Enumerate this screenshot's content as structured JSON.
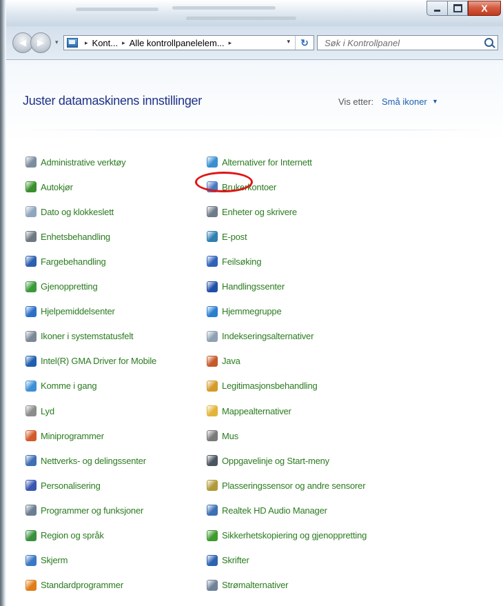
{
  "window": {
    "caption_buttons": {
      "minimize_icon": "minimize-icon",
      "maximize_icon": "maximize-icon",
      "close_label": "X"
    }
  },
  "toolbar": {
    "back_icon": "back-arrow-icon",
    "forward_icon": "forward-arrow-icon",
    "address": {
      "icon": "control-panel-icon",
      "breadcrumb": [
        "Kont...",
        "Alle kontrollpanelelem..."
      ],
      "separator": "▸",
      "dropdown_glyph": "▾",
      "refresh_glyph": "↻"
    },
    "search": {
      "placeholder": "Søk i Kontrollpanel",
      "icon": "search-icon"
    }
  },
  "main": {
    "title": "Juster datamaskinens innstillinger",
    "view_by": {
      "label": "Vis etter:",
      "value": "Små ikoner",
      "caret": "▼"
    },
    "columns": [
      {
        "items": [
          {
            "label": "Administrative verktøy",
            "icon": "administrative-tools-icon",
            "color": "#7d8c9e"
          },
          {
            "label": "Autokjør",
            "icon": "autoplay-icon",
            "color": "#3a8e2d"
          },
          {
            "label": "Dato og klokkeslett",
            "icon": "date-time-icon",
            "color": "#8fa6bf"
          },
          {
            "label": "Enhetsbehandling",
            "icon": "device-manager-icon",
            "color": "#6f7780"
          },
          {
            "label": "Fargebehandling",
            "icon": "color-management-icon",
            "color": "#2b5fb0"
          },
          {
            "label": "Gjenoppretting",
            "icon": "recovery-icon",
            "color": "#3a9a3a"
          },
          {
            "label": "Hjelpemiddelsenter",
            "icon": "ease-of-access-icon",
            "color": "#2d6fc8"
          },
          {
            "label": "Ikoner i systemstatusfelt",
            "icon": "notification-area-icon",
            "color": "#7a8896"
          },
          {
            "label": "Intel(R) GMA Driver for Mobile",
            "icon": "intel-gma-icon",
            "color": "#1f5fae"
          },
          {
            "label": "Komme i gang",
            "icon": "getting-started-icon",
            "color": "#3e8fd6"
          },
          {
            "label": "Lyd",
            "icon": "sound-icon",
            "color": "#8c8c8c"
          },
          {
            "label": "Miniprogrammer",
            "icon": "gadgets-icon",
            "color": "#d35a2a"
          },
          {
            "label": "Nettverks- og delingssenter",
            "icon": "network-sharing-icon",
            "color": "#3f6eb5"
          },
          {
            "label": "Personalisering",
            "icon": "personalization-icon",
            "color": "#3a56b0"
          },
          {
            "label": "Programmer og funksjoner",
            "icon": "programs-features-icon",
            "color": "#6b7d90"
          },
          {
            "label": "Region og språk",
            "icon": "region-language-icon",
            "color": "#3b8f3f"
          },
          {
            "label": "Skjerm",
            "icon": "display-icon",
            "color": "#3a77c4"
          },
          {
            "label": "Standardprogrammer",
            "icon": "default-programs-icon",
            "color": "#e07d1a"
          }
        ]
      },
      {
        "items": [
          {
            "label": "Alternativer for Internett",
            "icon": "internet-options-icon",
            "color": "#3a8fd1"
          },
          {
            "label": "Brukerkontoer",
            "icon": "user-accounts-icon",
            "color": "#4a78c0"
          },
          {
            "label": "Enheter og skrivere",
            "icon": "devices-printers-icon",
            "color": "#6e7b88"
          },
          {
            "label": "E-post",
            "icon": "mail-icon",
            "color": "#2f7fb0",
            "highlighted": true
          },
          {
            "label": "Feilsøking",
            "icon": "troubleshooting-icon",
            "color": "#2f63b8"
          },
          {
            "label": "Handlingssenter",
            "icon": "action-center-flag-icon",
            "color": "#1f4fa8"
          },
          {
            "label": "Hjemmegruppe",
            "icon": "homegroup-icon",
            "color": "#2a7fd0"
          },
          {
            "label": "Indekseringsalternativer",
            "icon": "indexing-options-icon",
            "color": "#8ea0b2"
          },
          {
            "label": "Java",
            "icon": "java-icon",
            "color": "#c65a2a"
          },
          {
            "label": "Legitimasjonsbehandling",
            "icon": "credential-manager-icon",
            "color": "#d49a2a"
          },
          {
            "label": "Mappealternativer",
            "icon": "folder-options-icon",
            "color": "#e3b43a"
          },
          {
            "label": "Mus",
            "icon": "mouse-icon",
            "color": "#7a7a7a"
          },
          {
            "label": "Oppgavelinje og Start-meny",
            "icon": "taskbar-start-icon",
            "color": "#4a5560"
          },
          {
            "label": "Plasseringssensor og andre sensorer",
            "icon": "location-sensors-icon",
            "color": "#b09a3a"
          },
          {
            "label": "Realtek HD Audio Manager",
            "icon": "realtek-audio-icon",
            "color": "#3c6fb4"
          },
          {
            "label": "Sikkerhetskopiering og gjenoppretting",
            "icon": "backup-restore-icon",
            "color": "#3f9a2f"
          },
          {
            "label": "Skrifter",
            "icon": "fonts-icon",
            "color": "#2d62b2"
          },
          {
            "label": "Strømalternativer",
            "icon": "power-options-icon",
            "color": "#6f8299"
          }
        ]
      }
    ]
  },
  "colors": {
    "link_green": "#2a7b1f",
    "title_blue": "#1e3287",
    "accent_blue": "#1d5fb3",
    "highlight_red": "#e01414"
  }
}
